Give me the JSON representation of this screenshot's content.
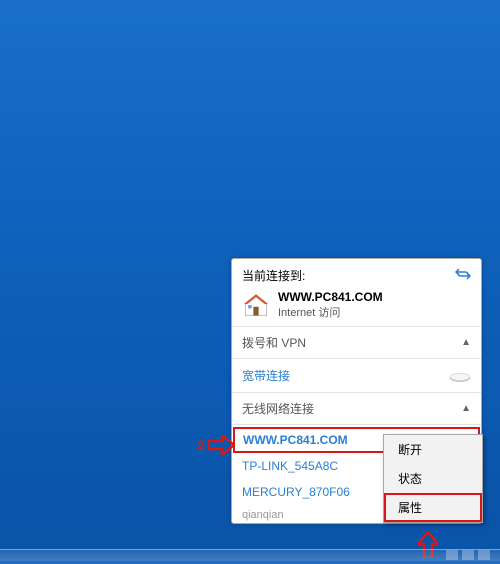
{
  "flyout": {
    "currently_connected_label": "当前连接到:",
    "connected_network_name": "WWW.PC841.COM",
    "connected_network_access": "Internet 访问",
    "dial_vpn_label": "拨号和 VPN",
    "broadband_link": "宽带连接",
    "wireless_label": "无线网络连接",
    "wifi_items": [
      "WWW.PC841.COM",
      "TP-LINK_545A8C",
      "MERCURY_870F06"
    ],
    "truncated_label": "qianqian"
  },
  "context_menu": {
    "disconnect": "断开",
    "status": "状态",
    "properties": "属性"
  },
  "annotations": {
    "step_number": "2"
  }
}
